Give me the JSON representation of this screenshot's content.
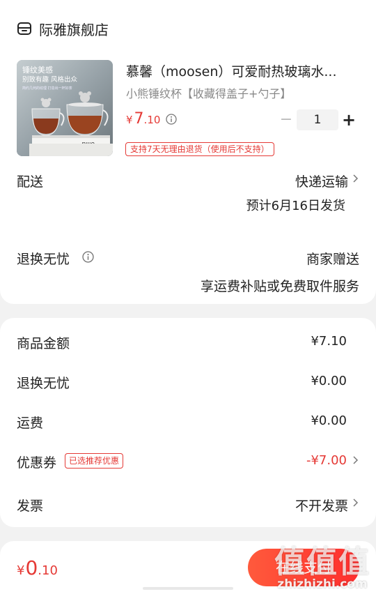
{
  "shop": {
    "name": "际雅旗舰店",
    "icon": "store-icon"
  },
  "product": {
    "title": "慕馨（moosen）可爱耐热玻璃水...",
    "spec": "小熊锤纹杯【收藏得盖子+勺子】",
    "price_symbol": "¥",
    "price_int": "7",
    "price_dec": ".10",
    "quantity": "1",
    "minus_label": "−",
    "plus_label": "+",
    "return_policy": "支持7天无理由退货（使用后不支持）",
    "image": {
      "line1": "锤纹美感",
      "line2": "别致有趣 风格出众",
      "line3": "简约几何的纹理 打造出一杯好茶",
      "book_text": "ollla"
    }
  },
  "delivery": {
    "label": "配送",
    "method": "快递运输",
    "eta": "预计6月16日发货"
  },
  "guarantee": {
    "label": "退换无忧",
    "value": "商家赠送",
    "desc": "享运费补贴或免费取件服务"
  },
  "summary": {
    "items": [
      {
        "label": "商品金额",
        "value": "¥7.10"
      },
      {
        "label": "退换无忧",
        "value": "¥0.00"
      },
      {
        "label": "运费",
        "value": "¥0.00"
      }
    ],
    "coupon": {
      "label": "优惠券",
      "badge": "已选推荐优惠",
      "value": "-¥7.00"
    },
    "invoice": {
      "label": "发票",
      "value": "不开发票"
    }
  },
  "footer": {
    "total_symbol": "¥",
    "total_int": "0",
    "total_dec": ".10",
    "pay_label": "在线支付"
  },
  "watermark": {
    "top": "值值值",
    "bottom": "zhizhizhi.com"
  },
  "colors": {
    "accent": "#e53935",
    "pay_gradient_start": "#ff5a3c",
    "pay_gradient_end": "#ff2e2e"
  }
}
